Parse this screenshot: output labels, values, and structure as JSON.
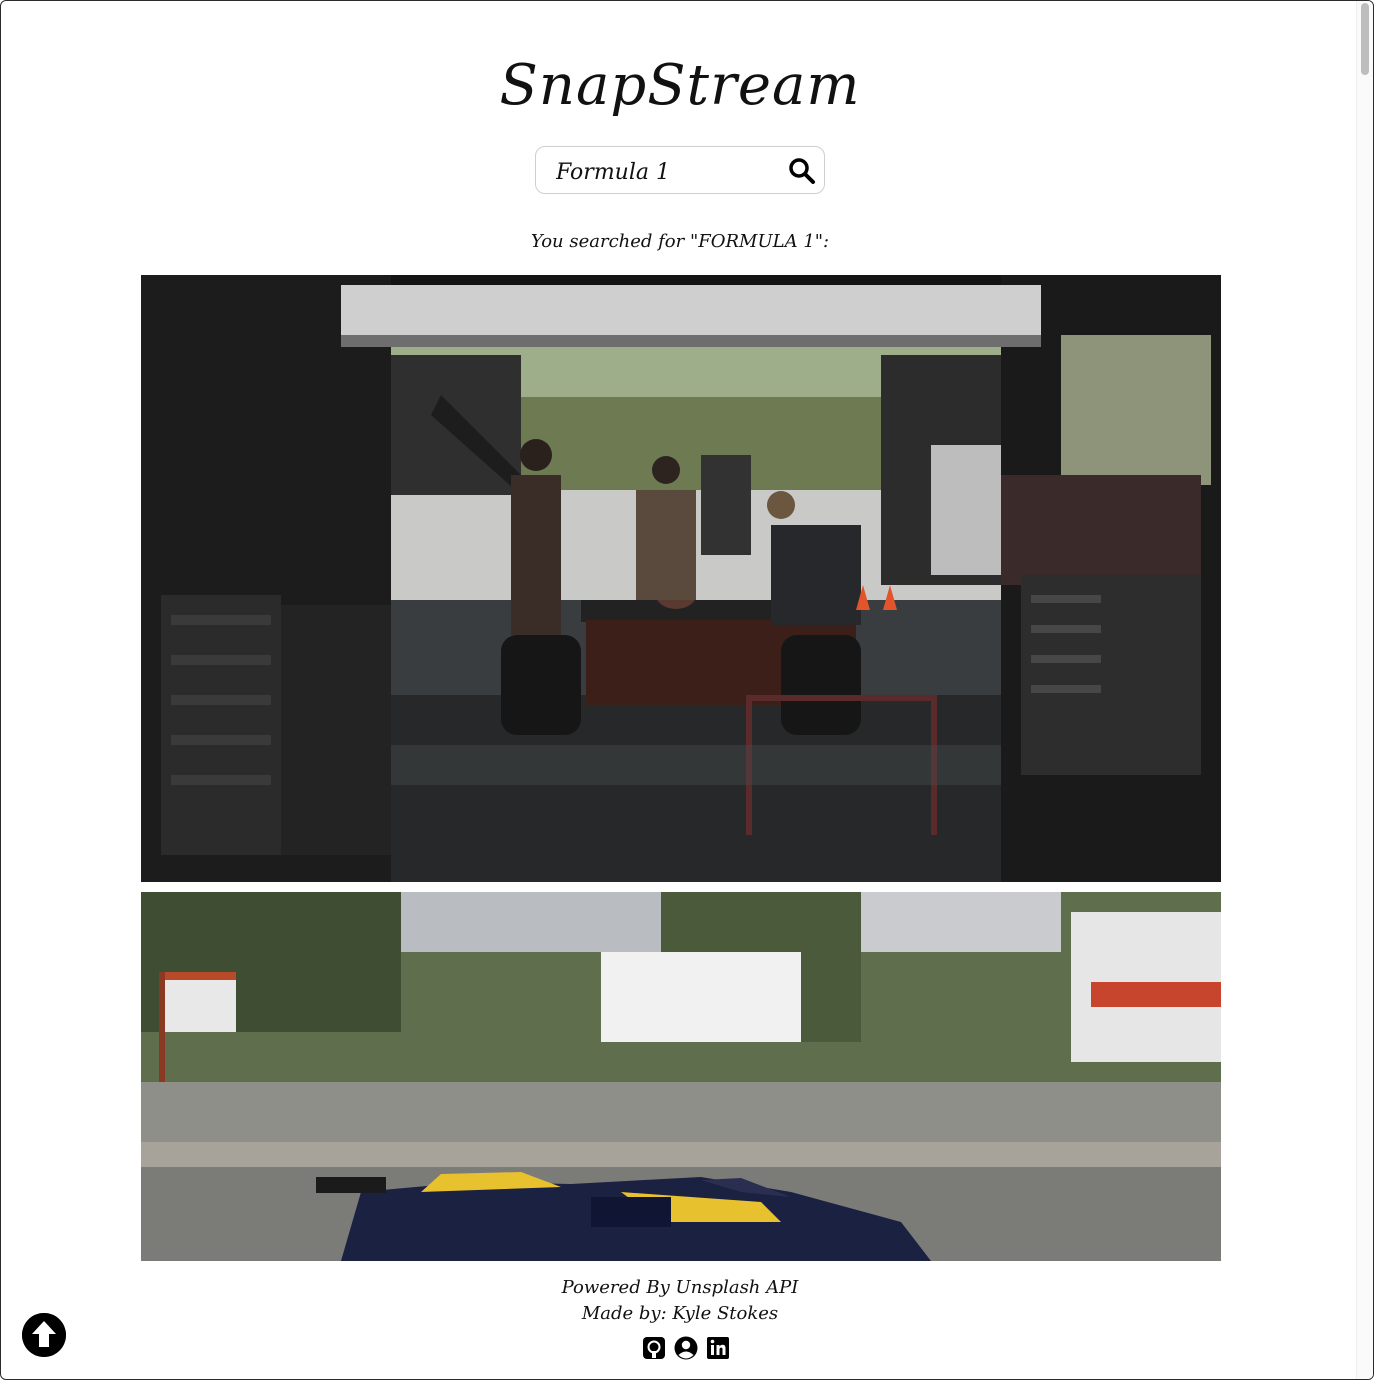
{
  "app": {
    "title": "SnapStream"
  },
  "search": {
    "value": "Formula 1",
    "placeholder": ""
  },
  "result_note": "You searched for \"FORMULA 1\":",
  "photos": [
    {
      "alt": "Vintage racing car being worked on in a pit garage"
    },
    {
      "alt": "Blue and yellow race car speeding past a track with motion blur"
    }
  ],
  "footer": {
    "powered_by": "Powered By Unsplash API",
    "made_by": "Made by: Kyle Stokes"
  },
  "icons": {
    "search": "search-icon",
    "github": "github-icon",
    "portfolio": "user-circle-icon",
    "linkedin": "linkedin-icon",
    "back_to_top": "arrow-up-circle-icon"
  }
}
